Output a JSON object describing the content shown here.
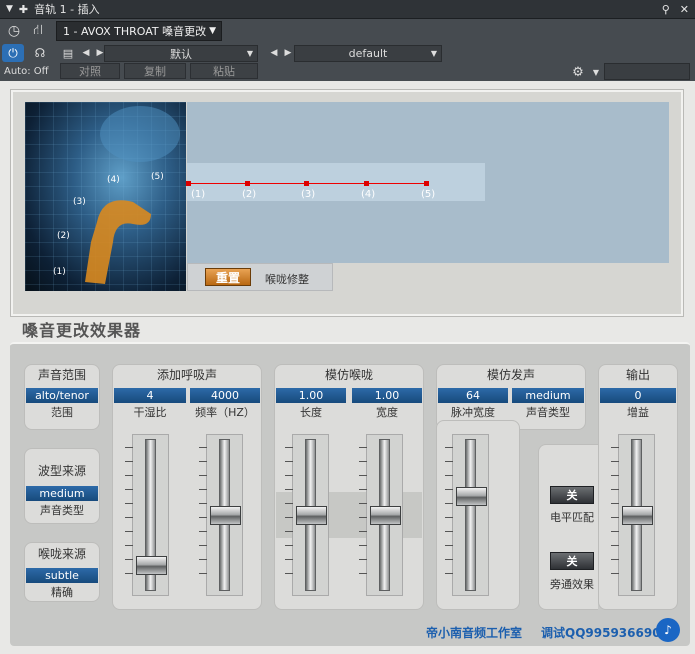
{
  "window": {
    "title": "音轨 1 - 插入"
  },
  "toolbar": {
    "tab_label": "1 - AVOX THROAT 嗓音更改",
    "preset_left": "默认",
    "preset_right": "default",
    "auto_label": "Auto: Off",
    "compare_label": "对照",
    "copy_label": "复制",
    "paste_label": "粘贴"
  },
  "graph": {
    "face_labels": [
      "(1)",
      "(2)",
      "(3)",
      "(4)",
      "(5)"
    ],
    "point_labels": [
      "(1)",
      "(2)",
      "(3)",
      "(4)",
      "(5)"
    ],
    "reset_label": "重置",
    "throat_adjust_label": "喉咙修整"
  },
  "brand": {
    "title": "嗓音更改效果器"
  },
  "groups": {
    "voice_range": {
      "title": "声音范围",
      "value": "alto/tenor",
      "label": "范围"
    },
    "waveform_source": {
      "title": "波型来源",
      "value": "medium",
      "label": "声音类型"
    },
    "throat_source": {
      "title": "喉咙来源",
      "value": "subtle",
      "label": "精确"
    },
    "breath": {
      "title": "添加呼吸声",
      "items": [
        {
          "value": "4",
          "label": "干湿比"
        },
        {
          "value": "4000",
          "label": "频率（HZ）"
        }
      ]
    },
    "throat_model": {
      "title": "模仿喉咙",
      "items": [
        {
          "value": "1.00",
          "label": "长度"
        },
        {
          "value": "1.00",
          "label": "宽度"
        }
      ]
    },
    "vocal_model": {
      "title": "模仿发声",
      "items": [
        {
          "value": "64",
          "label": "脉冲宽度"
        },
        {
          "value": "medium",
          "label": "声音类型"
        }
      ]
    },
    "output": {
      "title": "输出",
      "value": "0",
      "label": "增益"
    }
  },
  "toggles": {
    "level_match": {
      "state": "关",
      "label": "电平匹配"
    },
    "bypass": {
      "state": "关",
      "label": "旁通效果"
    }
  },
  "footer": {
    "studio": "帝小南音频工作室",
    "contact": "调试QQ995936690"
  },
  "slider_levels": {
    "dry_wet": 0.1,
    "freq": 0.5,
    "length": 0.5,
    "width": 0.5,
    "pulse": 0.65,
    "gain": 0.5
  },
  "colors": {
    "accent": "#2c6fb5",
    "value_bg": "#1f5b94",
    "reset": "#d3821f",
    "curve": "#e00000"
  }
}
